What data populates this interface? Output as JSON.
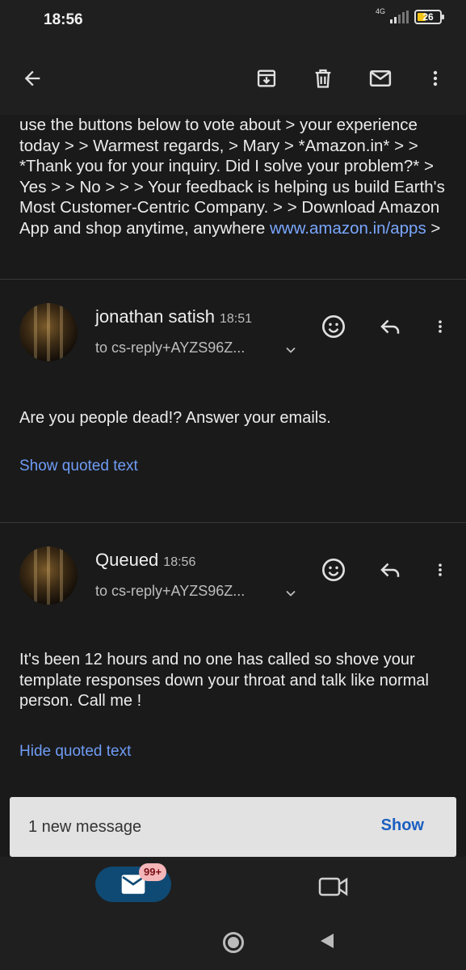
{
  "status_bar": {
    "time": "18:56",
    "network_label": "4G",
    "battery_level": "26"
  },
  "toolbar": {
    "back_icon": "arrow-back-icon",
    "archive_icon": "archive-icon",
    "delete_icon": "trash-icon",
    "mark_unread_icon": "mail-icon",
    "more_icon": "more-vert-icon"
  },
  "quoted_text": {
    "body": "use the buttons below to vote about > your experience today > > Warmest regards, > Mary > *Amazon.in* > > *Thank you for your inquiry. Did I solve your problem?* > Yes > > No > > > Your feedback is helping us build Earth's Most Customer-Centric Company. > > Download Amazon App and shop anytime, anywhere ",
    "link": "www.amazon.in/apps",
    "tail": " >"
  },
  "messages": [
    {
      "sender": "jonathan satish",
      "time": "18:51",
      "to": "to cs-reply+AYZS96Z...",
      "body": "Are you people dead!? Answer your emails.",
      "quoted_toggle": "Show quoted text"
    },
    {
      "sender": "Queued",
      "time": "18:56",
      "to": "to cs-reply+AYZS96Z...",
      "body": "It's been 12 hours and no one has called so shove your template responses down your throat and talk like normal person. Call me !",
      "quoted_toggle": "Hide quoted text"
    }
  ],
  "snackbar": {
    "message": "1 new message",
    "action": "Show"
  },
  "bottom_nav": {
    "mail_badge": "99+"
  },
  "colors": {
    "background": "#1a1a1a",
    "link": "#6f9cf5",
    "mail_pill": "#0f4a74",
    "badge": "#f4b6b8",
    "snackbar": "#e2e2e2"
  }
}
